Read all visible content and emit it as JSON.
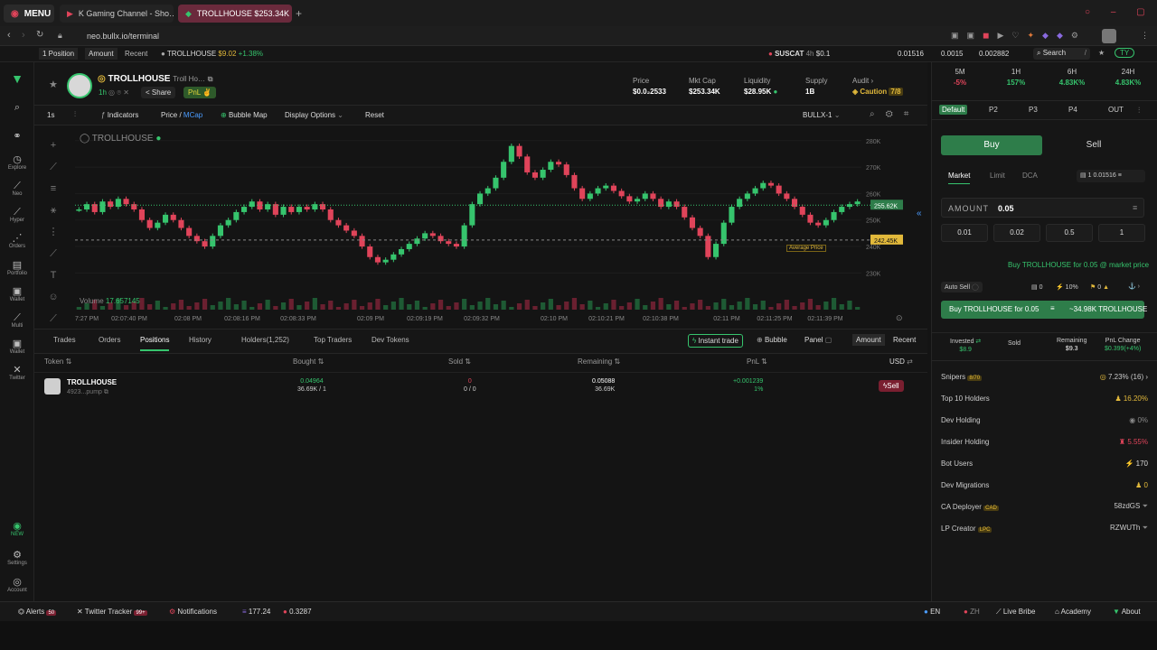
{
  "browser": {
    "menu_label": "MENU",
    "tab1_title": "K Gaming Channel - Sho…",
    "tab2_title": "TROLLHOUSE $253.34K",
    "new_tab": "+",
    "url": "neo.bullx.io/terminal"
  },
  "topstrip": {
    "positions": "1 Position",
    "amount": "Amount",
    "recent": "Recent",
    "ticker_name": "TROLLHOUSE",
    "ticker_price": "$9.02",
    "ticker_change": "+1.38%",
    "susc_name": "SUSCAT",
    "susc_age": "4h",
    "susc_val": "$0.1",
    "val1": "0.01516",
    "val2": "0.0015",
    "val3": "0.002882",
    "search": "Search",
    "search_key": "/",
    "profile": "TY"
  },
  "nav": {
    "items": [
      {
        "icon": "search-icon",
        "label": ""
      },
      {
        "icon": "link-icon",
        "label": ""
      },
      {
        "icon": "compass-icon",
        "label": "Explore"
      },
      {
        "icon": "neo-icon",
        "label": "Neo"
      },
      {
        "icon": "hyper-icon",
        "label": "Hyper"
      },
      {
        "icon": "orders-icon",
        "label": "Orders"
      },
      {
        "icon": "portfolio-icon",
        "label": "Portfolio"
      },
      {
        "icon": "wallet-icon",
        "label": "Wallet"
      },
      {
        "icon": "multi-chart-icon",
        "label": "Multi"
      },
      {
        "icon": "wallet2-icon",
        "label": "Wallet"
      },
      {
        "icon": "twitter-icon",
        "label": "Twitter"
      }
    ],
    "new_badge": "NEW",
    "settings": "Settings",
    "account": "Account"
  },
  "token": {
    "name": "TROLLHOUSE",
    "full": "Troll Ho…",
    "age": "1h",
    "share": "Share",
    "pnl": "PnL",
    "price_label": "Price",
    "price": "$0.0₂2533",
    "mcap_label": "Mkt Cap",
    "mcap": "$253.34K",
    "liq_label": "Liquidity",
    "liq": "$28.95K",
    "supply_label": "Supply",
    "supply": "1B",
    "audit_label": "Audit",
    "audit": "Caution",
    "audit_score": "7/8"
  },
  "charttools": {
    "interval": "1s",
    "indicators": "Indicators",
    "price": "Price",
    "mcap": "MCap",
    "bubble_map": "Bubble Map",
    "display_options": "Display Options",
    "reset": "Reset",
    "bullx": "BULLX-1"
  },
  "chart_data": {
    "type": "candlestick",
    "symbol": "TROLLHOUSE",
    "y_ticks": [
      "280K",
      "270K",
      "260K",
      "250K",
      "240K",
      "230K"
    ],
    "price_tag": "255.62K",
    "avg_tag": "242.45K",
    "avg_label": "Average Price",
    "volume_label": "Volume",
    "volume_value": "17.657145",
    "x_ticks": [
      "7:27 PM",
      "02:07:40 PM",
      "02:08 PM",
      "02:08:16 PM",
      "02:08:33 PM",
      "02:09 PM",
      "02:09:19 PM",
      "02:09:32 PM",
      "02:10 PM",
      "02:10:21 PM",
      "02:10:38 PM",
      "02:11 PM",
      "02:11:25 PM",
      "02:11:39 PM"
    ],
    "ylim": [
      225,
      283
    ],
    "close": [
      254,
      256,
      253,
      257,
      255,
      258,
      256,
      254,
      250,
      247,
      249,
      252,
      250,
      247,
      244,
      242,
      240,
      244,
      248,
      250,
      253,
      255,
      257,
      254,
      256,
      252,
      255,
      253,
      255,
      254,
      256,
      254,
      250,
      248,
      246,
      244,
      240,
      236,
      234,
      235,
      237,
      239,
      241,
      243,
      245,
      244,
      242,
      241,
      240,
      248,
      256,
      260,
      262,
      266,
      272,
      278,
      274,
      268,
      266,
      269,
      272,
      271,
      267,
      262,
      258,
      260,
      262,
      263,
      261,
      259,
      257,
      258,
      260,
      258,
      255,
      257,
      255,
      251,
      247,
      244,
      236,
      241,
      249,
      255,
      258,
      260,
      262,
      264,
      263,
      260,
      258,
      255,
      252,
      249,
      248,
      250,
      253,
      255,
      256,
      257
    ]
  },
  "bottom": {
    "tabs": [
      "Trades",
      "Orders",
      "Positions",
      "History",
      "Holders(1,252)",
      "Top Traders",
      "Dev Tokens"
    ],
    "instant_trade": "Instant trade",
    "bubble": "Bubble",
    "panel": "Panel",
    "amount": "Amount",
    "recent": "Recent",
    "headers": [
      "Token",
      "Bought",
      "Sold",
      "Remaining",
      "PnL",
      "USD"
    ],
    "row": {
      "token": "TROLLHOUSE",
      "addr": "4923...pump",
      "bought": "0.04964",
      "bought_sub": "36.69K / 1",
      "sold": "0",
      "sold_sub": "0 / 0",
      "remaining": "0.05088",
      "remaining_sub": "36.69K",
      "pnl": "+0.001239",
      "pnl_pct": "1%",
      "sell": "Sell"
    }
  },
  "right": {
    "stats": [
      {
        "k": "5M",
        "v": "-5%"
      },
      {
        "k": "1H",
        "v": "157%"
      },
      {
        "k": "6H",
        "v": "4.83K%"
      },
      {
        "k": "24H",
        "v": "4.83K%"
      }
    ],
    "presets": [
      "Default",
      "P2",
      "P3",
      "P4",
      "OUT"
    ],
    "buy": "Buy",
    "sell": "Sell",
    "order_types": [
      "Market",
      "Limit",
      "DCA"
    ],
    "wallet_count": "1",
    "wallet_balance": "0.01516",
    "amount_label": "AMOUNT",
    "amount_value": "0.05",
    "quick": [
      "0.01",
      "0.02",
      "0.5",
      "1"
    ],
    "buy_hint": "Buy TROLLHOUSE for 0.05 @ market price",
    "auto_sell": "Auto Sell",
    "as_a": "0",
    "as_b": "10%",
    "as_c": "0",
    "buy_btn": "Buy TROLLHOUSE for 0.05",
    "buy_btn_right": "~34.98K TROLLHOUSE",
    "invested_label": "Invested",
    "invested": "$8.9",
    "sold_label": "Sold",
    "remaining_label": "Remaining",
    "remaining": "$9.3",
    "pnl_label": "PnL Change",
    "pnl": "$0.399(+4%)",
    "snipers_label": "Snipers",
    "snipers_badge": "8/70",
    "snipers_val": "7.23% (16)",
    "metrics": [
      {
        "k": "Top 10 Holders",
        "v": "16.20%"
      },
      {
        "k": "Dev Holding",
        "v": "0%"
      },
      {
        "k": "Insider Holding",
        "v": "5.55%"
      },
      {
        "k": "Bot Users",
        "v": "170"
      },
      {
        "k": "Dev Migrations",
        "v": "0"
      }
    ],
    "ca_label": "CA Deployer",
    "ca_badge": "CAD",
    "ca_val": "58zdGS",
    "lp_label": "LP Creator",
    "lp_badge": "LPC",
    "lp_val": "RZWUTh"
  },
  "status": {
    "alerts": "Alerts",
    "alerts_count": "50",
    "twitter": "Twitter Tracker",
    "twitter_count": "99+",
    "notifications": "Notifications",
    "sol_price": "177.24",
    "other_price": "0.3287",
    "lang": "EN",
    "zh": "ZH",
    "live": "Live Bribe",
    "academy": "Academy",
    "about": "About"
  },
  "colors": {
    "green": "#36c46d",
    "red": "#e0445a",
    "gold": "#e2b93b",
    "bg": "#141414"
  }
}
